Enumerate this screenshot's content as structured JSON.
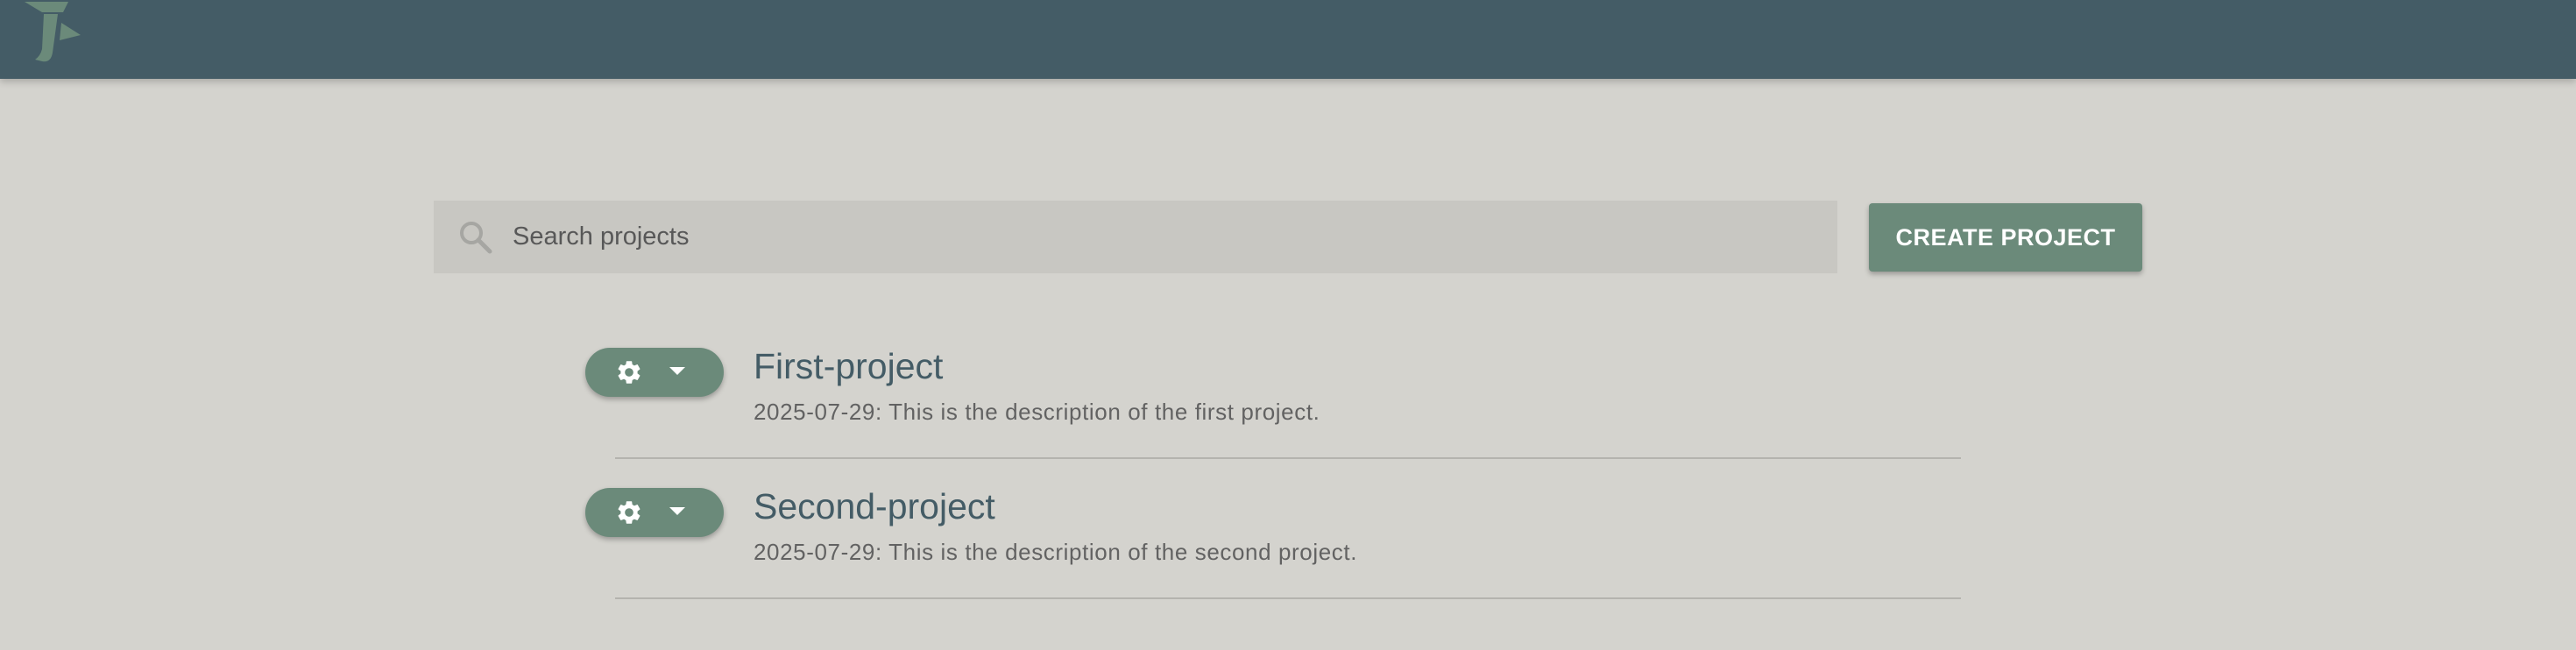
{
  "app": {
    "logo_icon": "app-logo-icon"
  },
  "search": {
    "placeholder": "Search projects",
    "value": "",
    "icon": "search-icon"
  },
  "create_button": {
    "label": "CREATE PROJECT"
  },
  "projects": [
    {
      "title": "First-project",
      "description": "2025-07-29: This is the description of the first project.",
      "menu_icons": [
        "gear-icon",
        "chevron-down-icon"
      ]
    },
    {
      "title": "Second-project",
      "description": "2025-07-29: This is the description of the second project.",
      "menu_icons": [
        "gear-icon",
        "chevron-down-icon"
      ]
    }
  ],
  "colors": {
    "header": "#445c66",
    "background": "#d4d3ce",
    "accent": "#6b8a7a",
    "search_bg": "#c8c7c2",
    "title": "#445c66"
  }
}
